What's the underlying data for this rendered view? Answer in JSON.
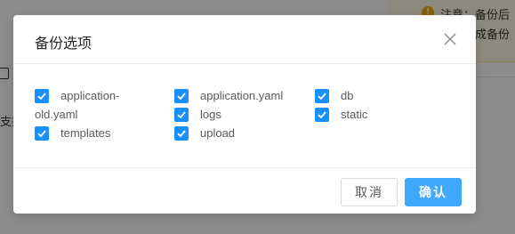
{
  "background": {
    "notice_icon": "!",
    "notice_title": "注意：备份后",
    "notice_line2": "成备份",
    "support_text": "支持"
  },
  "dialog": {
    "title": "备份选项",
    "close_icon": "close-icon",
    "options": [
      {
        "label": "application-old.yaml",
        "checked": true
      },
      {
        "label": "application.yaml",
        "checked": true
      },
      {
        "label": "db",
        "checked": true
      },
      {
        "label": "logs",
        "checked": true
      },
      {
        "label": "static",
        "checked": true
      },
      {
        "label": "templates",
        "checked": true
      },
      {
        "label": "upload",
        "checked": true
      }
    ],
    "cancel_label": "取消",
    "confirm_label": "确认"
  },
  "colors": {
    "checkbox": "#1890ff",
    "primary_button": "#40a9ff",
    "notice_icon": "#faad14"
  }
}
